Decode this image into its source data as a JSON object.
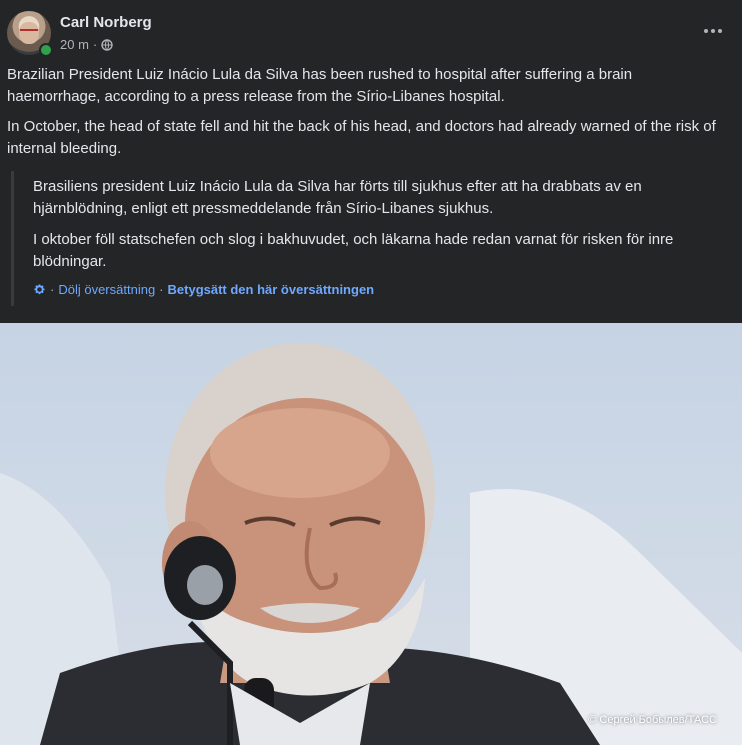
{
  "post": {
    "author": "Carl Norberg",
    "time": "20 m",
    "separator": "·",
    "paragraphs": [
      "Brazilian President Luiz Inácio Lula da Silva has been rushed to hospital after suffering a brain haemorrhage, according to a press release from the Sírio-Libanes hospital.",
      "In October, the head of state fell and hit the back of his head, and doctors had already warned of the risk of internal bleeding."
    ],
    "translation": {
      "paragraphs": [
        "Brasiliens president Luiz Inácio Lula da Silva har förts till sjukhus efter att ha drabbats av en hjärnblödning, enligt ett pressmeddelande från Sírio-Libanes sjukhus.",
        "I oktober föll statschefen och slog i bakhuvudet, och läkarna hade redan varnat för risken för inre blödningar."
      ],
      "sep": "·",
      "hide_label": "Dölj översättning",
      "rate_label": "Betygsätt den här översättningen"
    },
    "photo_credit": "© Сергей Бобылев/ТАСС"
  },
  "icons": {
    "avatar": "avatar",
    "online": "online-status-dot",
    "audience": "globe-icon",
    "more": "more-options-icon",
    "settings": "gear-icon"
  },
  "colors": {
    "background": "#242526",
    "text": "#e4e6eb",
    "secondary_text": "#b0b3b8",
    "link": "#6ea8ff",
    "online": "#31a24c"
  }
}
